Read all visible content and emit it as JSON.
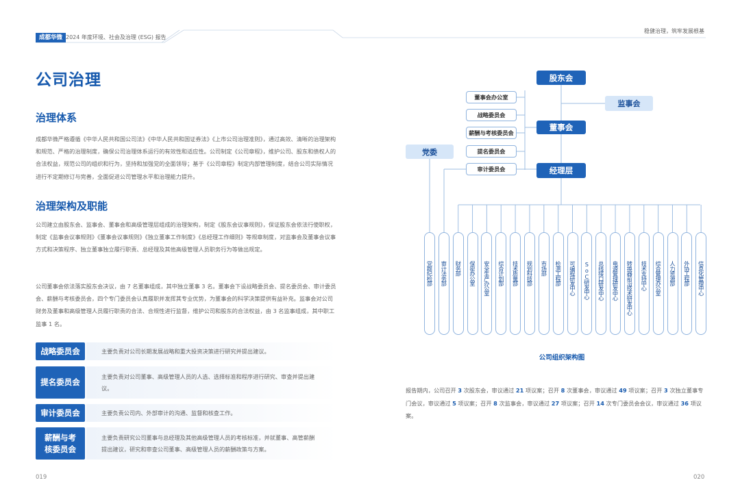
{
  "header": {
    "brand": "成都华微",
    "report_title": "2024 年度环境、社会及治理 (ESG) 报告",
    "right_slogan": "稳健治理，筑牢发展根基"
  },
  "left": {
    "title": "公司治理",
    "section1": {
      "title": "治理体系",
      "paragraph": "成都华微严格遵循《中华人民共和国公司法》《中华人民共和国证券法》《上市公司治理准则》，通过高效、清晰的治理架构和规范、严格的治理制度，确保公司治理体系运行的有效性和适应性。公司制定《公司章程》，维护公司、股东和债权人的合法权益，规范公司的组织和行为，坚持和加强党的全面领导；基于《公司章程》制定内部管理制度，结合公司实际情况进行不定期修订与完善，全面促进公司管理水平和治理能力提升。"
    },
    "section2": {
      "title": "治理架构及职能",
      "paragraph1": "公司建立由股东会、监事会、董事会和高级管理层组成的治理架构，制定《股东会议事规则》，保证股东会依法行使职权，制定《监事会议事规则》《董事会议事规则》《独立董事工作制度》《总经理工作细则》等规章制度，对监事会及董事会议事方式和决策程序、独立董事独立履行职责、总经理及其他高级管理人员职务行为等做出规定。",
      "paragraph2": "公司董事会依法落实股东会决议，由 7 名董事组成，其中独立董事 3 名。董事会下设战略委员会、提名委员会、审计委员会、薪酬与考核委员会，四个专门委员会认真履职并发挥其专业优势，为董事会的科学决策提供有益补充。监事会对公司财务及董事和高级管理人员履行职责的合法、合规性进行监督，维护公司和股东的合法权益，由 3 名监事组成，其中职工监事 1 名。"
    },
    "committees": [
      {
        "name": "战略委员会",
        "desc": "主要负责对公司长期发展战略和重大投资决策进行研究并提出建议。"
      },
      {
        "name": "提名委员会",
        "desc": "主要负责对公司董事、高级管理人员的人选、选择标准和程序进行研究、审查并提出建议。"
      },
      {
        "name": "审计委员会",
        "desc": "主要负责公司内、外部审计的沟通、监督和核查工作。"
      },
      {
        "name": "薪酬与考核委员会",
        "desc": "主要负责研究公司董事与总经理及其他高级管理人员的考核标准，并就董事、高管薪酬提出建议，研究和审查公司董事、高级管理人员的薪酬政策与方案。"
      }
    ],
    "page_number": "019"
  },
  "right": {
    "org": {
      "shareholders": "股东会",
      "supervisors": "监事会",
      "board": "董事会",
      "management": "经理层",
      "party": "党委",
      "board_units": [
        "董事会办公室",
        "战略委员会",
        "薪酬与考核委员会",
        "提名委员会",
        "审计委员会"
      ],
      "departments": [
        "党群纪检部",
        "审计法务部",
        "财务部",
        "保密办公室",
        "安全生产办公室",
        "综合计划部",
        "技术质量部",
        "规划科技部",
        "市场部",
        "检测工程部",
        "可编程研发中心",
        "SoC研发中心",
        "总线接口研发中心",
        "电源管理研发中心",
        "转换器前沿技术研发中心",
        "技术支持中心",
        "综合管理办公室",
        "人力资源部",
        "外协工程部",
        "信息化管理中心"
      ]
    },
    "caption": "公司组织架构图",
    "summary": {
      "t1": "报告期内，公司召开 ",
      "n1": "3",
      "t2": " 次股东会，审议通过 ",
      "n2": "21",
      "t3": " 项议案；召开 ",
      "n3": "8",
      "t4": " 次董事会，审议通过 ",
      "n4": "49",
      "t5": " 项议案；召开 ",
      "n5": "3",
      "t6": " 次独立董事专门会议，审议通过 ",
      "n6": "5",
      "t7": " 项议案；召开 ",
      "n7": "8",
      "t8": " 次监事会，审议通过 ",
      "n8": "27",
      "t9": " 项议案；召开 ",
      "n9": "14",
      "t10": " 次专门委员会会议，审议通过 ",
      "n10": "36",
      "t11": " 项议案。"
    },
    "page_number": "020"
  },
  "colors": {
    "primary": "#1f63b8",
    "heading": "#1659ad",
    "light_box": "#d6e6f8",
    "line": "#8fb3de"
  }
}
